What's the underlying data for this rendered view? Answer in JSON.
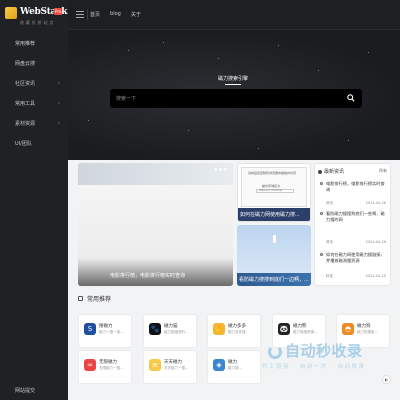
{
  "logo": {
    "brand": "WebStack",
    "badge": "Pro",
    "tagline": "收 藏 优 质 站 点"
  },
  "sidebar": {
    "items": [
      {
        "label": "常用推荐",
        "has_children": false
      },
      {
        "label": "网盘云搜",
        "has_children": false
      },
      {
        "label": "社区资讯",
        "has_children": true
      },
      {
        "label": "常用工具",
        "has_children": true
      },
      {
        "label": "素材资源",
        "has_children": true
      },
      {
        "label": "UI/团队",
        "has_children": false
      }
    ],
    "bottom": "网站提交"
  },
  "topbar": {
    "links": [
      "首页",
      "blog",
      "关于"
    ]
  },
  "hero": {
    "tab": "磁力搜索引擎",
    "search_placeholder": "搜索一下"
  },
  "slider": {
    "caption": "电影排行榜，电影排行榜实时查询"
  },
  "card_a": {
    "caption": "如何在磁力网使用磁力搜...",
    "dialog_title": "请将链接复制到浏览器中播放并访问",
    "dialog_text": "被访问域名为",
    "dialog_url": "https://h.x3dd.top/"
  },
  "card_b": {
    "caption": "看防磁力搜搜到底们一边啊，..."
  },
  "news": {
    "title": "最新资讯",
    "more": "所有",
    "items": [
      {
        "title": "电影排行榜，电影排行榜实时查询",
        "meta": "资讯",
        "date": "2024-04-26"
      },
      {
        "title": "看防磁力搜搜到底们一些啊，磁力搜的网",
        "meta": "资讯",
        "date": "2024-04-26"
      },
      {
        "title": "如何在磁力网使用磁力搜链接，并播放磁测量资源",
        "meta": "科技",
        "date": "2024-04-25"
      }
    ]
  },
  "section": {
    "title": "常用推荐"
  },
  "tiles": [
    {
      "name": "搜磁力",
      "desc": "磁力一搜一接...",
      "color": "#1f4f9e",
      "glyph": "S"
    },
    {
      "name": "磁力猫",
      "desc": "磁力猫搜资料...",
      "color": "#111111",
      "glyph": "🐾"
    },
    {
      "name": "磁力多多",
      "desc": "磁力多多搜...",
      "color": "#f5b731",
      "glyph": "✋"
    },
    {
      "name": "磁力熊",
      "desc": "磁力熊搜资源...",
      "color": "#222222",
      "glyph": "🐼"
    },
    {
      "name": "磁力狗",
      "desc": "磁力狗搜索...",
      "color": "#f08a24",
      "glyph": "◓"
    },
    {
      "name": "无限磁力",
      "desc": "无限磁力一搜...",
      "color": "#e94545",
      "glyph": "∞"
    },
    {
      "name": "天天磁力",
      "desc": "天天磁力一搜...",
      "color": "#f7c948",
      "glyph": "≡"
    },
    {
      "name": "磁力",
      "desc": "磁力搜...",
      "color": "#3a86d1",
      "glyph": "◈"
    }
  ],
  "watermark": {
    "main": "自动秒收录",
    "sub": "秒上链接 · 自动一次 · 自动收录"
  }
}
